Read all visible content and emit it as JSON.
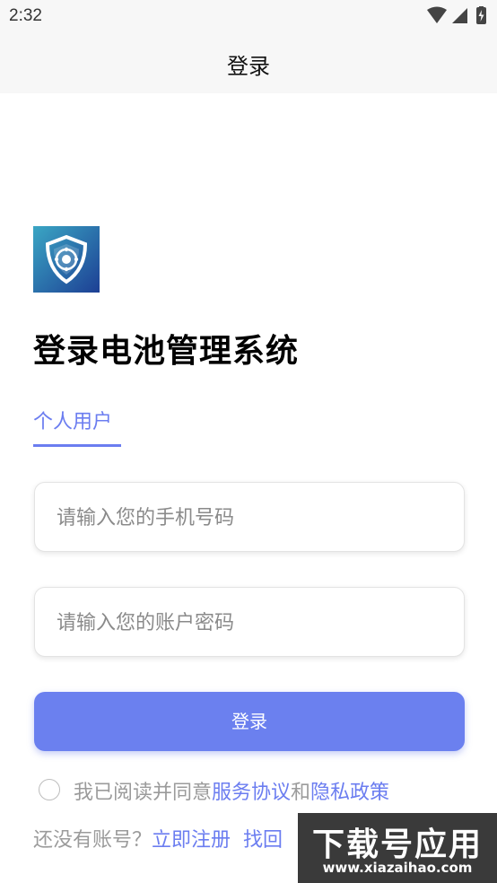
{
  "status_bar": {
    "time": "2:32",
    "icons": [
      "wifi-icon",
      "cellular-signal-icon",
      "battery-charging-icon"
    ]
  },
  "nav": {
    "title": "登录"
  },
  "logo": {
    "icon": "shield-logo-icon",
    "colors": [
      "#3aa6c4",
      "#1d3f94"
    ]
  },
  "main": {
    "title": "登录电池管理系统",
    "tabs": [
      {
        "label": "个人用户",
        "active": true
      }
    ],
    "phone_input": {
      "placeholder": "请输入您的手机号码",
      "value": ""
    },
    "password_input": {
      "placeholder": "请输入您的账户密码",
      "value": ""
    },
    "login_button": "登录"
  },
  "agreement": {
    "checked": false,
    "prefix": "我已阅读并同意",
    "service_link": "服务协议",
    "and": "和",
    "privacy_link": "隐私政策"
  },
  "bottom": {
    "no_account": "还没有账号？",
    "register_link": "立即注册",
    "find_link": "找回"
  },
  "watermark": {
    "main": "下载号应用",
    "url": "www.xiazaihao.com"
  },
  "colors": {
    "accent": "#6b7df0",
    "button": "#6b80ef",
    "bar_background": "#f7f7f7"
  }
}
